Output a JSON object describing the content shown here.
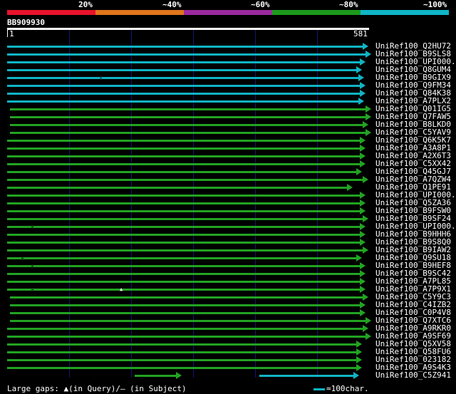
{
  "colors": {
    "red": "#e8132b",
    "orange": "#e0761c",
    "purple": "#9a2a9e",
    "green": "#1c9a1c",
    "cyan": "#0fb6c6",
    "hit_green": "#22a322",
    "hit_cyan": "#10b4c4",
    "grid": "#15157a"
  },
  "scale": {
    "labels": [
      "20%",
      "~40%",
      "~60%",
      "~80%",
      "~100%"
    ]
  },
  "query": {
    "name": "BB909930",
    "start": "1",
    "end": "581"
  },
  "hits": [
    {
      "name": "UniRef100_Q2HU72",
      "color": "cyan",
      "start": 0,
      "end": 580
    },
    {
      "name": "UniRef100_B9SLS8",
      "color": "cyan",
      "start": 0,
      "end": 585
    },
    {
      "name": "UniRef100_UPI000..",
      "color": "cyan",
      "start": 0,
      "end": 575
    },
    {
      "name": "UniRef100_Q8GUM4",
      "color": "cyan",
      "start": 0,
      "end": 570
    },
    {
      "name": "UniRef100_B9GIX9",
      "color": "cyan",
      "start": 0,
      "end": 573
    },
    {
      "name": "UniRef100_Q9FM34",
      "color": "cyan",
      "start": 0,
      "end": 575
    },
    {
      "name": "UniRef100_Q84K38",
      "color": "cyan",
      "start": 0,
      "end": 575
    },
    {
      "name": "UniRef100_A7PLX2",
      "color": "cyan",
      "start": 0,
      "end": 573
    },
    {
      "name": "UniRef100_Q01IG5",
      "color": "green",
      "start": 5,
      "end": 585
    },
    {
      "name": "UniRef100_Q7FAW5",
      "color": "green",
      "start": 5,
      "end": 585
    },
    {
      "name": "UniRef100_B8LKD0",
      "color": "green",
      "start": 5,
      "end": 580
    },
    {
      "name": "UniRef100_C5YAV9",
      "color": "green",
      "start": 5,
      "end": 585
    },
    {
      "name": "UniRef100_Q6K5K7",
      "color": "green",
      "start": 0,
      "end": 575
    },
    {
      "name": "UniRef100_A3A8P1",
      "color": "green",
      "start": 0,
      "end": 575
    },
    {
      "name": "UniRef100_A2X6T3",
      "color": "green",
      "start": 0,
      "end": 575
    },
    {
      "name": "UniRef100_C5XX42",
      "color": "green",
      "start": 0,
      "end": 575
    },
    {
      "name": "UniRef100_Q45GJ7",
      "color": "green",
      "start": 0,
      "end": 570
    },
    {
      "name": "UniRef100_A7QZW4",
      "color": "green",
      "start": 0,
      "end": 580
    },
    {
      "name": "UniRef100_Q1PE91",
      "color": "green",
      "start": 0,
      "end": 555
    },
    {
      "name": "UniRef100_UPI000..",
      "color": "green",
      "start": 0,
      "end": 575
    },
    {
      "name": "UniRef100_Q5ZA36",
      "color": "green",
      "start": 0,
      "end": 575
    },
    {
      "name": "UniRef100_B9FSW0",
      "color": "green",
      "start": 0,
      "end": 575
    },
    {
      "name": "UniRef100_B9SF24",
      "color": "green",
      "start": 0,
      "end": 580
    },
    {
      "name": "UniRef100_UPI000..",
      "color": "green",
      "start": 0,
      "end": 575
    },
    {
      "name": "UniRef100_B9HHH6",
      "color": "green",
      "start": 0,
      "end": 575
    },
    {
      "name": "UniRef100_B9S8Q0",
      "color": "green",
      "start": 0,
      "end": 575
    },
    {
      "name": "UniRef100_B9IAW2",
      "color": "green",
      "start": 0,
      "end": 580
    },
    {
      "name": "UniRef100_Q9SU18",
      "color": "green",
      "start": 0,
      "end": 570
    },
    {
      "name": "UniRef100_B9HEF8",
      "color": "green",
      "start": 0,
      "end": 575
    },
    {
      "name": "UniRef100_B9SC42",
      "color": "green",
      "start": 0,
      "end": 575
    },
    {
      "name": "UniRef100_A7PL85",
      "color": "green",
      "start": 0,
      "end": 575
    },
    {
      "name": "UniRef100_A7P9X1",
      "color": "green",
      "start": 0,
      "end": 575
    },
    {
      "name": "UniRef100_C5Y9C3",
      "color": "green",
      "start": 5,
      "end": 580
    },
    {
      "name": "UniRef100_C4IZB2",
      "color": "green",
      "start": 5,
      "end": 575
    },
    {
      "name": "UniRef100_C0P4V8",
      "color": "green",
      "start": 5,
      "end": 575
    },
    {
      "name": "UniRef100_Q7XTC6",
      "color": "green",
      "start": 5,
      "end": 585
    },
    {
      "name": "UniRef100_A9RKR0",
      "color": "green",
      "start": 0,
      "end": 580
    },
    {
      "name": "UniRef100_A9SF69",
      "color": "green",
      "start": 0,
      "end": 585
    },
    {
      "name": "UniRef100_Q5XV58",
      "color": "green",
      "start": 0,
      "end": 570
    },
    {
      "name": "UniRef100_Q58FU6",
      "color": "green",
      "start": 0,
      "end": 570
    },
    {
      "name": "UniRef100_023182",
      "color": "green",
      "start": 0,
      "end": 570
    },
    {
      "name": "UniRef100_A9S4K3",
      "color": "green",
      "start": 0,
      "end": 570
    },
    {
      "name": "UniRef100_C5Z941",
      "color": "green",
      "start": 205,
      "end": 280,
      "second": {
        "color": "cyan",
        "start": 405,
        "end": 565
      }
    }
  ],
  "legend": {
    "gaps_text": "Large gaps: ▲(in Query)/– (in Subject)",
    "scale_text": "=100char."
  }
}
